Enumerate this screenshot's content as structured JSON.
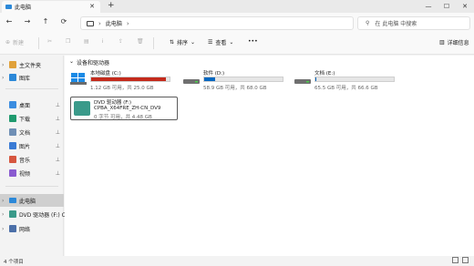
{
  "window": {
    "tab_title": "此电脑",
    "tab_close": "✕",
    "new_tab": "+",
    "controls": [
      "—",
      "☐",
      "✕"
    ]
  },
  "address": {
    "back": "←",
    "forward": "→",
    "up": "↑",
    "refresh": "⟳",
    "crumb_sep": "›",
    "crumb": "此电脑",
    "crumb_end": "›",
    "search_placeholder": "在 此电脑 中搜索"
  },
  "toolbar": {
    "new_label": "新建",
    "sort_label": "排序",
    "view_label": "查看",
    "more_label": "•••",
    "details_label": "详细信息"
  },
  "sidebar": {
    "items": [
      {
        "label": "主文件夹",
        "pin": ""
      },
      {
        "label": "图库",
        "pin": ""
      },
      {
        "label": "桌面",
        "pin": "📌"
      },
      {
        "label": "下载",
        "pin": "📌"
      },
      {
        "label": "文档",
        "pin": "📌"
      },
      {
        "label": "图片",
        "pin": "📌"
      },
      {
        "label": "音乐",
        "pin": "📌"
      },
      {
        "label": "视频",
        "pin": "📌"
      },
      {
        "label": "此电脑",
        "pin": ""
      },
      {
        "label": "DVD 驱动器 (F:) C",
        "pin": ""
      },
      {
        "label": "网络",
        "pin": ""
      }
    ]
  },
  "main": {
    "section_title": "设备和驱动器",
    "drives": [
      {
        "name": "本地磁盘 (C:)",
        "free_text": "1.12 GB 可用，共 25.0 GB",
        "used_fraction": 0.955,
        "bar_color": "#c42b1c"
      },
      {
        "name": "软件 (D:)",
        "free_text": "58.9 GB 可用，共 68.0 GB",
        "used_fraction": 0.134,
        "bar_color": "#0067c0"
      },
      {
        "name": "文档 (E:)",
        "free_text": "65.5 GB 可用，共 66.6 GB",
        "used_fraction": 0.017,
        "bar_color": "#0067c0"
      }
    ],
    "dvd": {
      "name": "DVD 驱动器 (F:)",
      "label": "CPBA_X64FRE_ZH-CN_DV9",
      "info": "0 字节 可用，共 4.48 GB"
    }
  },
  "status": {
    "count": "4 个项目"
  }
}
